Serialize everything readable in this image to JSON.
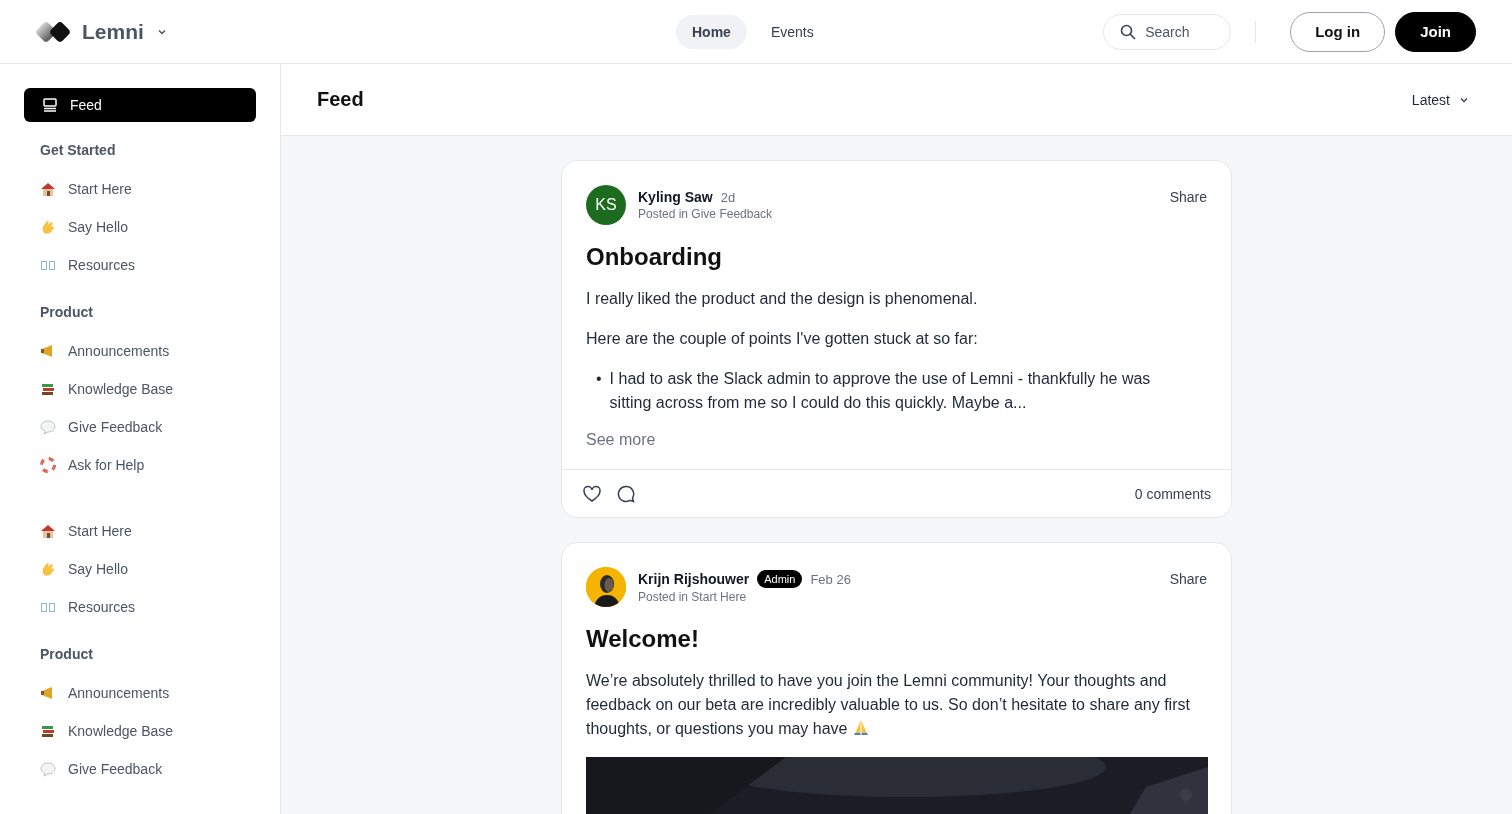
{
  "header": {
    "brand": "Lemni",
    "nav": [
      {
        "label": "Home",
        "selected": true
      },
      {
        "label": "Events",
        "selected": false
      }
    ],
    "search": {
      "placeholder": "Search"
    },
    "buttons": [
      {
        "label": "Log in",
        "kind": "outline"
      },
      {
        "label": "Join",
        "kind": "solid"
      }
    ]
  },
  "sidebar": {
    "feed": {
      "label": "Feed",
      "selected": true
    },
    "sections": [
      {
        "title": "Get Started",
        "items": [
          {
            "label": "Start Here"
          },
          {
            "label": "Say Hello"
          },
          {
            "label": "Resources"
          }
        ]
      },
      {
        "title": "Product",
        "items": [
          {
            "label": "Announcements"
          },
          {
            "label": "Knowledge Base"
          },
          {
            "label": "Give Feedback"
          },
          {
            "label": "Ask for Help"
          }
        ]
      },
      {
        "items": [
          {
            "label": "Start Here"
          },
          {
            "label": "Say Hello"
          },
          {
            "label": "Resources"
          }
        ]
      },
      {
        "title": "Product",
        "items": [
          {
            "label": "Announcements"
          },
          {
            "label": "Knowledge Base"
          },
          {
            "label": "Give Feedback"
          }
        ]
      }
    ]
  },
  "page": {
    "title": "Feed",
    "sort": "Latest"
  },
  "posts": [
    {
      "author": "Kyling Saw",
      "avatar": {
        "kind": "initials",
        "initials": "KS",
        "color": "#1d6b1f"
      },
      "time": "2d",
      "posted_in": "Posted in Give Feedback",
      "share": "Share",
      "title": "Onboarding",
      "body": [
        {
          "kind": "paragraph",
          "text": "I really liked the product and the design is phenomenal."
        },
        {
          "kind": "paragraph",
          "text": "Here are the couple of points I've gotten stuck at so far:"
        },
        {
          "kind": "bullets",
          "items": [
            {
              "marker": "•",
              "text": "I had to ask the Slack admin to approve the use of Lemni - thankfully he was sitting across from me so I could do this quickly. Maybe a..."
            }
          ]
        }
      ],
      "see_more": "See more",
      "comments": "0 comments"
    },
    {
      "author": "Krijn Rijshouwer",
      "avatar": {
        "kind": "picture",
        "color": "#f5b400"
      },
      "badge": "Admin",
      "time": "Feb 26",
      "posted_in": "Posted in Start Here",
      "share": "Share",
      "title": "Welcome!",
      "body": [
        {
          "kind": "emoji_paragraph",
          "text": "We’re absolutely thrilled to have you join the Lemni community! Your thoughts and feedback on our beta are incredibly valuable to us. So don’t hesitate to share any first thoughts, or questions you may have"
        },
        {
          "kind": "media"
        }
      ]
    }
  ]
}
